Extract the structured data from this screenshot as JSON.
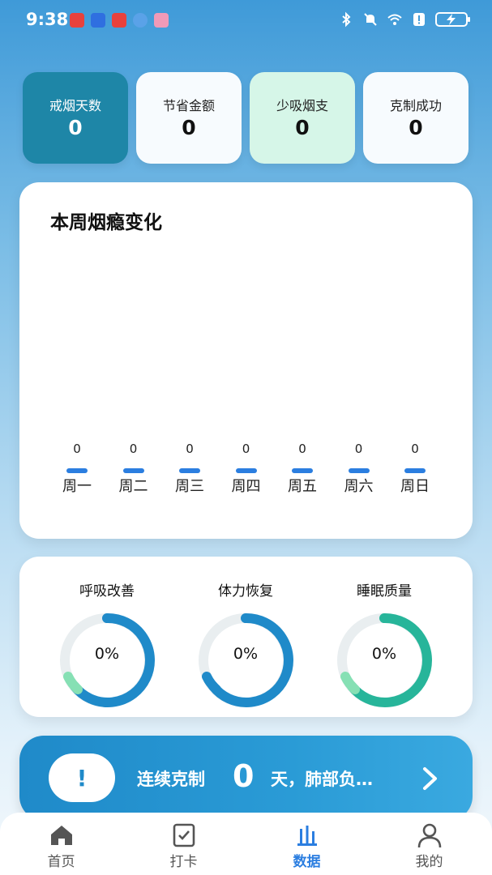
{
  "status_bar": {
    "time": "9:38",
    "app_icons": [
      "huawei-app-icon",
      "bulb-app-icon",
      "huawei-app-icon",
      "browser-app-icon",
      "gallery-app-icon"
    ],
    "right_icons": [
      "bluetooth-icon",
      "mute-icon",
      "wifi-icon",
      "alert-icon",
      "battery-charging-icon"
    ]
  },
  "stats": [
    {
      "label": "戒烟天数",
      "value": "0",
      "active": true
    },
    {
      "label": "节省金额",
      "value": "0",
      "active": false
    },
    {
      "label": "少吸烟支",
      "value": "0",
      "active": false
    },
    {
      "label": "克制成功",
      "value": "0",
      "active": false
    }
  ],
  "weekly": {
    "title": "本周烟瘾变化",
    "chart_data": {
      "type": "bar",
      "title": "本周烟瘾变化",
      "categories": [
        "周一",
        "周二",
        "周三",
        "周四",
        "周五",
        "周六",
        "周日"
      ],
      "values": [
        0,
        0,
        0,
        0,
        0,
        0,
        0
      ]
    }
  },
  "recovery": [
    {
      "label": "呼吸改善",
      "percent": "0%",
      "ring_color": "#1f8ac9",
      "accent_color": "#86e0b4"
    },
    {
      "label": "体力恢复",
      "percent": "0%",
      "ring_color": "#1f8ac9",
      "accent_color": "#1f8ac9"
    },
    {
      "label": "睡眠质量",
      "percent": "0%",
      "ring_color": "#27b59a",
      "accent_color": "#86e0b4"
    }
  ],
  "banner": {
    "badge": "!",
    "text_before": "连续克制",
    "days": "0",
    "text_after": "天，肺部负…"
  },
  "nav": [
    {
      "label": "首页",
      "icon": "home-icon",
      "active": false
    },
    {
      "label": "打卡",
      "icon": "checkin-icon",
      "active": false
    },
    {
      "label": "数据",
      "icon": "chart-icon",
      "active": true
    },
    {
      "label": "我的",
      "icon": "profile-icon",
      "active": false
    }
  ],
  "colors": {
    "primary": "#1f8ac9",
    "active_card": "#1e86a7",
    "mint_card": "#d6f6e8",
    "nav_active": "#2b7ee0"
  }
}
